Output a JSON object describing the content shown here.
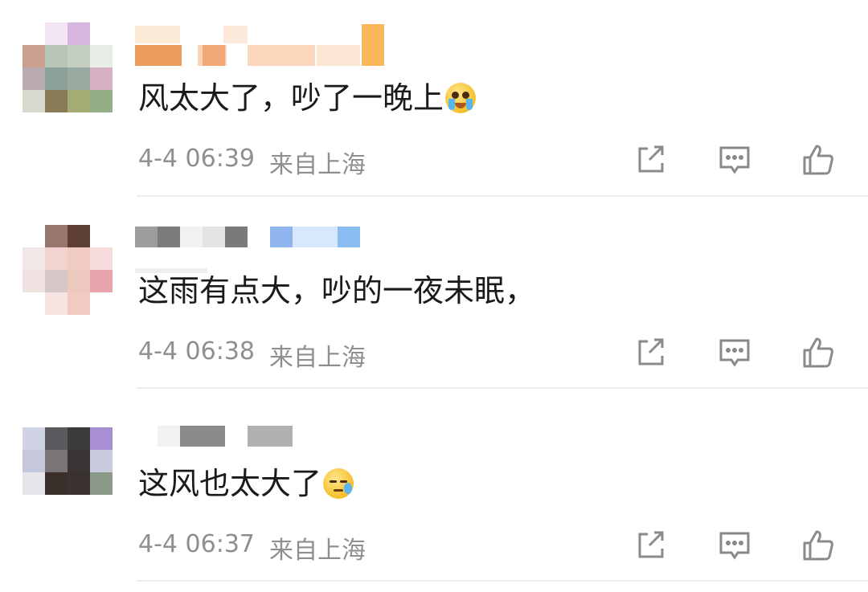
{
  "comments": [
    {
      "text": "风太大了，吵了一晚上",
      "emoji": "crying-face-emoji",
      "time": "4-4 06:39",
      "location": "来自上海",
      "actions": [
        "share-icon",
        "comment-icon",
        "like-icon"
      ]
    },
    {
      "text": "这雨有点大，吵的一夜未眠，",
      "emoji": "",
      "time": "4-4 06:38",
      "location": "来自上海",
      "actions": [
        "share-icon",
        "comment-icon",
        "like-icon"
      ]
    },
    {
      "text": "这风也太大了",
      "emoji": "sweat-face-emoji",
      "time": "4-4 06:37",
      "location": "来自上海",
      "actions": [
        "share-icon",
        "comment-icon",
        "like-icon"
      ]
    }
  ],
  "colors": {
    "text": "#1a1a1a",
    "meta": "#8f8f8f",
    "icon": "#8a8a8a",
    "divider": "#ececec"
  }
}
